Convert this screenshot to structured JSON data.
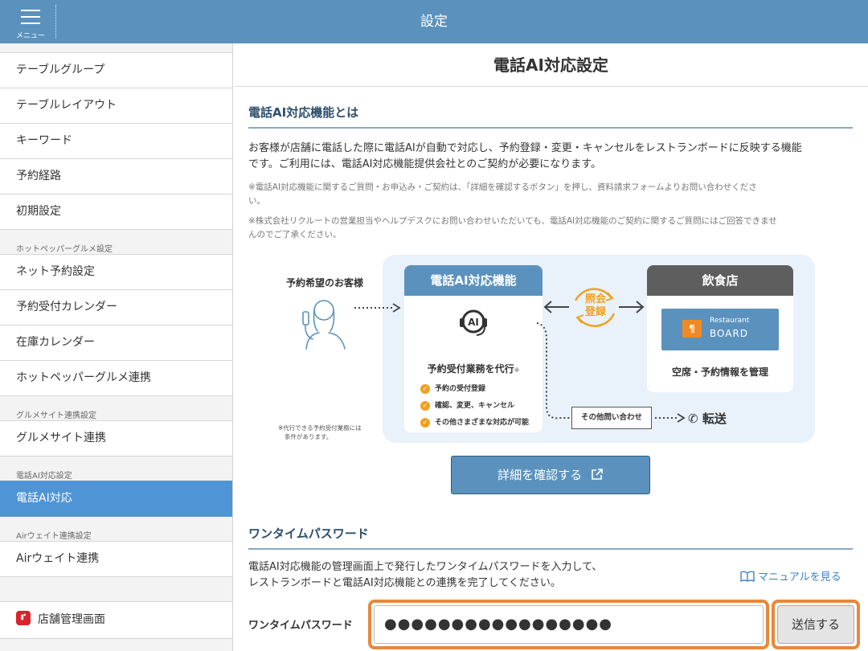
{
  "header": {
    "title": "設定",
    "menu_label": "メニュー"
  },
  "sidebar": {
    "items": [
      {
        "label": "テーブルグループ"
      },
      {
        "label": "テーブルレイアウト"
      },
      {
        "label": "キーワード"
      },
      {
        "label": "予約経路"
      },
      {
        "label": "初期設定"
      },
      {
        "label": "ネット予約設定"
      },
      {
        "label": "予約受付カレンダー"
      },
      {
        "label": "在庫カレンダー"
      },
      {
        "label": "ホットペッパーグルメ連携"
      },
      {
        "label": "グルメサイト連携"
      },
      {
        "label": "電話AI対応"
      },
      {
        "label": "Airウェイト連携"
      },
      {
        "label": "店舗管理画面"
      }
    ],
    "sections": {
      "hotpepper": "ホットペッパーグルメ設定",
      "gourmet": "グルメサイト連携設定",
      "phone_ai": "電話AI対応設定",
      "airwait": "Airウェイト連携設定"
    },
    "active_item": "電話AI対応"
  },
  "main": {
    "title": "電話AI対応設定",
    "about": {
      "heading": "電話AI対応機能とは",
      "line1": "お客様が店舗に電話した際に電話AIが自動で対応し、予約登録・変更・キャンセルをレストランボードに反映する機能",
      "line2": "です。ご利用には、電話AI対応機能提供会社とのご契約が必要になります。",
      "note1": "※電話AI対応機能に関するご質問・お申込み・ご契約は、「詳細を確認するボタン」を押し、資料請求フォームよりお問い合わせくださ",
      "note1b": "い。",
      "note2": "※株式会社リクルートの営業担当やヘルプデスクにお問い合わせいただいても、電話AI対応機能のご契約に関するご質問にはご回答できませ",
      "note2b": "んのでご了承ください。"
    },
    "diagram": {
      "customer_label": "予約希望のお客様",
      "ai_title": "電話AI対応機能",
      "ai_icon_text": "AI",
      "ai_task": "予約受付業務を代行",
      "ai_task_mark": "※",
      "ai_tasks": [
        "予約の受付登録",
        "確認、変更、キャンセル",
        "その他さまざまな対応が可能"
      ],
      "ref_line1": "照会",
      "ref_line2": "登録",
      "shop_title": "飲食店",
      "logo_line1": "Restaurant",
      "logo_line2": "BOARD",
      "shop_desc": "空席・予約情報を管理",
      "other_inquiry": "その他問い合わせ",
      "transfer": "転送",
      "footnote1": "※代行できる予約受付業務には",
      "footnote2": "条件があります。"
    },
    "detail_button": "詳細を確認する",
    "otp": {
      "heading": "ワンタイムパスワード",
      "desc1": "電話AI対応機能の管理画面上で発行したワンタイムパスワードを入力して、",
      "desc2": "レストランボードと電話AI対応機能との連携を完了してください。",
      "manual_link": "マニュアルを見る",
      "label": "ワンタイムパスワード",
      "value": "●●●●●●●●●●●●●●●●●",
      "send": "送信する"
    }
  },
  "colors": {
    "header": "#5b92bd",
    "active": "#4f94d4",
    "highlight": "#e8883a",
    "accent_orange": "#f2a020"
  }
}
